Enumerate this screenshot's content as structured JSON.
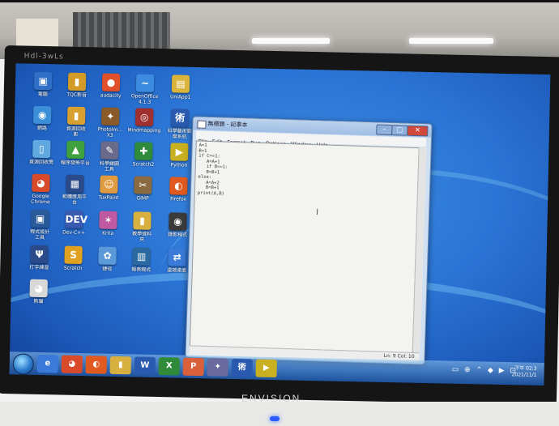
{
  "monitor": {
    "brand": "ENVISION",
    "bezel_label": "Hdl-3wLs"
  },
  "desktop_icons": [
    {
      "id": "computer",
      "label": "電腦",
      "color": "#2f6fc8",
      "glyph": "▣"
    },
    {
      "id": "tqc",
      "label": "TQC影音",
      "color": "#d39a25",
      "glyph": "▮"
    },
    {
      "id": "audacity",
      "label": "audacity",
      "color": "#e0502a",
      "glyph": "●"
    },
    {
      "id": "openoffice",
      "label": "OpenOffice\n4.1.3",
      "color": "#3d8be0",
      "glyph": "~"
    },
    {
      "id": "uniapp",
      "label": "UniApp1",
      "color": "#d8b43a",
      "glyph": "▤"
    },
    {
      "id": "network",
      "label": "網路",
      "color": "#3a8fd8",
      "glyph": "◉"
    },
    {
      "id": "folder1",
      "label": "資源回收\n影",
      "color": "#d8a030",
      "glyph": "▮"
    },
    {
      "id": "photoimpact",
      "label": "PhotoIm...\nX3",
      "color": "#8a5a2a",
      "glyph": "✦"
    },
    {
      "id": "mindmap",
      "label": "Mindmapping",
      "color": "#a03030",
      "glyph": "◎"
    },
    {
      "id": "art",
      "label": "科學藝術觀\n摩系統",
      "color": "#2a5ab0",
      "glyph": "術"
    },
    {
      "id": "recycle",
      "label": "資源回收筒",
      "color": "#5fa8e0",
      "glyph": "▯"
    },
    {
      "id": "publisher",
      "label": "程序發佈平台",
      "color": "#3fa040",
      "glyph": "▲"
    },
    {
      "id": "drawtool",
      "label": "科學繪圖\n工具",
      "color": "#6a6a8a",
      "glyph": "✎"
    },
    {
      "id": "scratch2",
      "label": "Scratch2",
      "color": "#2f8a3a",
      "glyph": "✚"
    },
    {
      "id": "python",
      "label": "Python",
      "color": "#c8b020",
      "glyph": "▶"
    },
    {
      "id": "chrome",
      "label": "Google\nChrome",
      "color": "#d84a2a",
      "glyph": "◕"
    },
    {
      "id": "softapp",
      "label": "軟體應用平\n台",
      "color": "#2a4a8a",
      "glyph": "▦"
    },
    {
      "id": "tuxpaint",
      "label": "TuxPaint",
      "color": "#e09a40",
      "glyph": "☺"
    },
    {
      "id": "gimp",
      "label": "GIMP",
      "color": "#8a6a40",
      "glyph": "✂"
    },
    {
      "id": "firefox",
      "label": "Firefox",
      "color": "#e05a20",
      "glyph": "◐"
    },
    {
      "id": "ide",
      "label": "程式設計\n工具",
      "color": "#2a5a9a",
      "glyph": "▣"
    },
    {
      "id": "devcpp",
      "label": "Dev-C++",
      "color": "#3a5ab0",
      "glyph": "DEV"
    },
    {
      "id": "krita",
      "label": "Krita",
      "color": "#c05aa0",
      "glyph": "✶"
    },
    {
      "id": "folder2",
      "label": "教學資料\n夾",
      "color": "#d8b040",
      "glyph": "▮"
    },
    {
      "id": "obs",
      "label": "錄影程式",
      "color": "#3a3a3a",
      "glyph": "◉"
    },
    {
      "id": "typing",
      "label": "打字練習",
      "color": "#2a4a8a",
      "glyph": "Ψ"
    },
    {
      "id": "scratch",
      "label": "Scratch",
      "color": "#e0a020",
      "glyph": "S"
    },
    {
      "id": "shortcut",
      "label": "捷徑",
      "color": "#5a9ad8",
      "glyph": "✿"
    },
    {
      "id": "report",
      "label": "報表程式",
      "color": "#2a6aa0",
      "glyph": "▥"
    },
    {
      "id": "remote",
      "label": "遠端桌面",
      "color": "#3a7ad8",
      "glyph": "⇄"
    },
    {
      "id": "panda",
      "label": "熊貓",
      "color": "#d8d8d8",
      "glyph": "◕"
    }
  ],
  "notepad": {
    "title": "無標題 - 記事本",
    "menu": [
      "File",
      "Edit",
      "Format",
      "Run",
      "Options",
      "Window",
      "Help"
    ],
    "code": "A=1\nB=1\nif C==1:\n   A=A+1\n   if B==1:\n   B=B+1\nelse:\n   A=A+2\n   B=B+1\nprint(A,B)",
    "cursor_char": "I",
    "status": "Ln: 9  Col: 10",
    "buttons": {
      "minimize": "–",
      "maximize": "□",
      "close": "✕"
    }
  },
  "taskbar": {
    "apps": [
      {
        "id": "ie",
        "color": "#3a7ad8",
        "glyph": "e"
      },
      {
        "id": "chrome",
        "color": "#d84a2a",
        "glyph": "◕"
      },
      {
        "id": "firefox",
        "color": "#e05a20",
        "glyph": "◐"
      },
      {
        "id": "explorer",
        "color": "#d8b040",
        "glyph": "▮"
      },
      {
        "id": "word",
        "color": "#2a5ab0",
        "glyph": "W"
      },
      {
        "id": "excel",
        "color": "#2f8a3a",
        "glyph": "X"
      },
      {
        "id": "powerpoint",
        "color": "#d8603a",
        "glyph": "P"
      },
      {
        "id": "idle",
        "color": "#6a6aa0",
        "glyph": "✦"
      },
      {
        "id": "art",
        "color": "#2a5ab0",
        "glyph": "術"
      },
      {
        "id": "python",
        "color": "#c8b020",
        "glyph": "▶"
      }
    ],
    "tray": "▭ ⊕ ⌃ ◆ ▶ ⊡",
    "time": "下午 02:3",
    "date": "2021/11/1"
  }
}
